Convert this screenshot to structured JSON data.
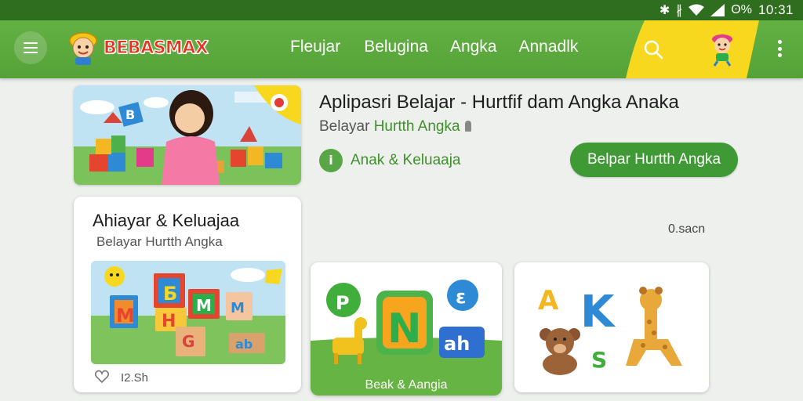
{
  "status_bar": {
    "battery": "ʘ%",
    "time": "10:31"
  },
  "app": {
    "logo_text": "BEBASMAX"
  },
  "nav": {
    "items": [
      {
        "label": "Fleujar"
      },
      {
        "label": "Belugina"
      },
      {
        "label": "Angka"
      },
      {
        "label": "Annadlk"
      }
    ]
  },
  "featured": {
    "title": "Aplipasri Belajar - Hurtfif dam Angka Anaka",
    "subtitle_prefix": "Belayar ",
    "subtitle_highlight": "Hurtth Angka",
    "category_label": "Anak & Keluaaja",
    "cta_label": "Belpar Hurtth Angka"
  },
  "sort_label": "0.sacn",
  "cards": [
    {
      "title": "Ahiayar & Keluajaa",
      "subtitle": "Belayar Hurtth Angka",
      "fav_count": "I2.Sh"
    },
    {
      "label": "Beak & Aangia",
      "letters": [
        "P",
        "N",
        "ε",
        "ah"
      ]
    },
    {
      "letters": [
        "A",
        "K",
        "S"
      ]
    }
  ],
  "colors": {
    "appbar_green": "#5aab3c",
    "status_green": "#2f6e1e",
    "accent_yellow": "#f7d81f",
    "cta_green": "#3f9a35"
  },
  "icons": {
    "menu": "hamburger-menu-icon",
    "search": "search-icon",
    "more": "more-vert-icon",
    "fav": "heart-icon",
    "category": "info-icon"
  }
}
